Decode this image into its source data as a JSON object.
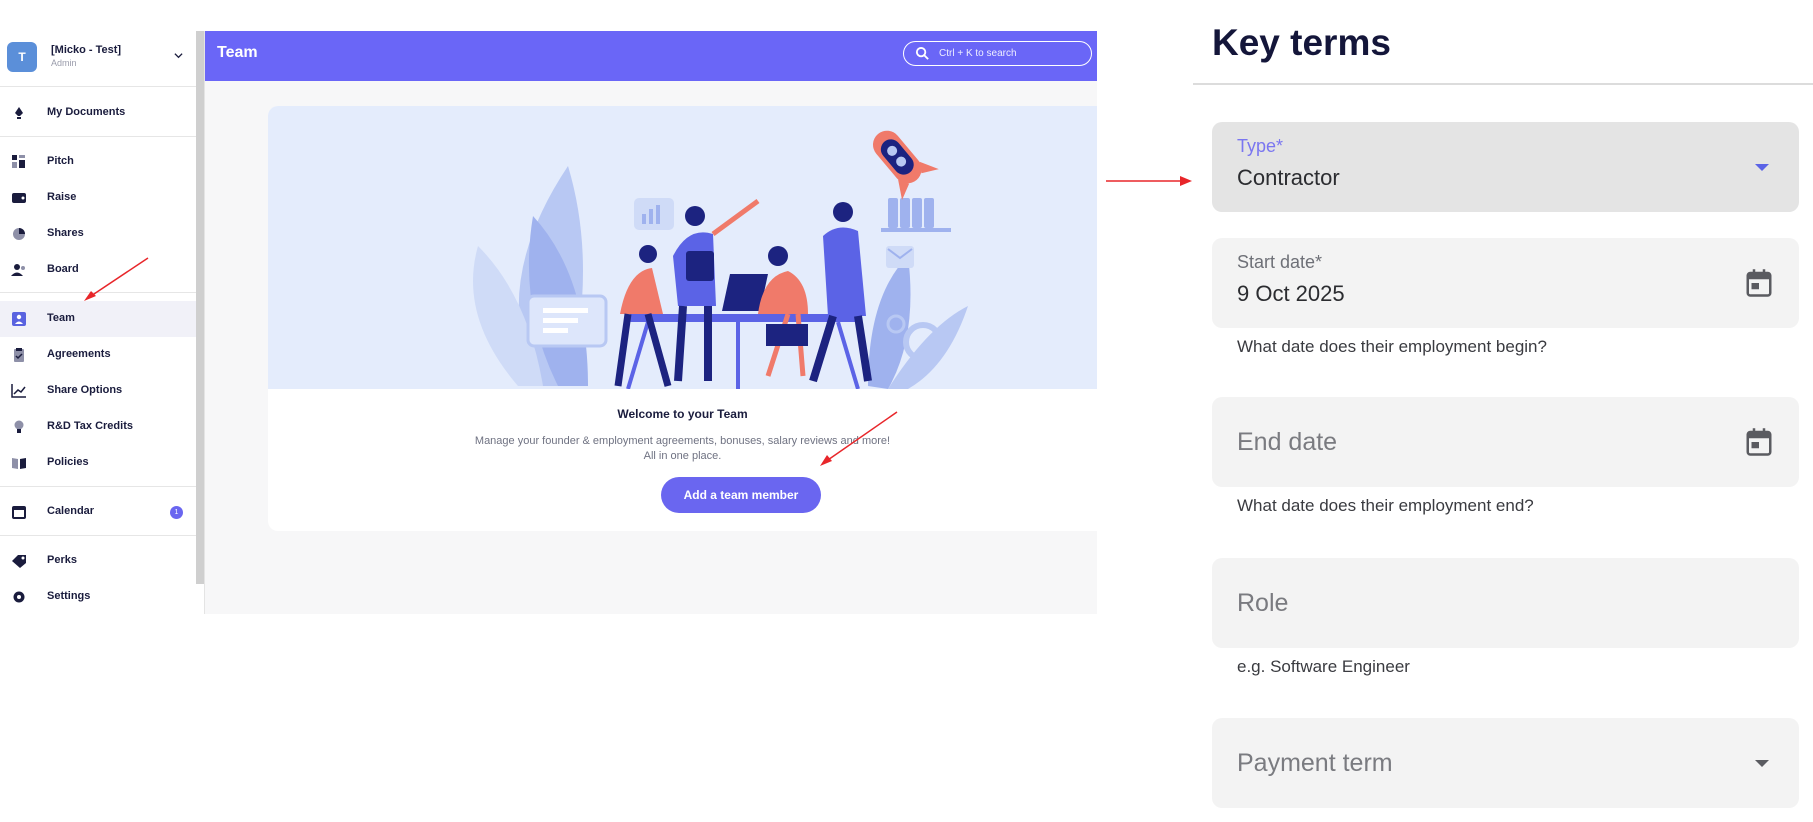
{
  "org": {
    "avatar_letter": "T",
    "name": "[Micko - Test]",
    "role": "Admin"
  },
  "sidebar": {
    "items": [
      {
        "label": "My Documents",
        "icon": "pen-nib-icon"
      },
      {
        "label": "Pitch",
        "icon": "pitch-blocks-icon"
      },
      {
        "label": "Raise",
        "icon": "wallet-icon"
      },
      {
        "label": "Shares",
        "icon": "pie-chart-icon"
      },
      {
        "label": "Board",
        "icon": "people-icon"
      },
      {
        "label": "Team",
        "icon": "person-badge-icon",
        "active": true
      },
      {
        "label": "Agreements",
        "icon": "clipboard-icon"
      },
      {
        "label": "Share Options",
        "icon": "line-chart-icon"
      },
      {
        "label": "R&D Tax Credits",
        "icon": "lightbulb-icon"
      },
      {
        "label": "Policies",
        "icon": "book-icon"
      },
      {
        "label": "Calendar",
        "icon": "calendar-icon",
        "badge": "1"
      },
      {
        "label": "Perks",
        "icon": "tag-icon"
      },
      {
        "label": "Settings",
        "icon": "gear-icon"
      }
    ]
  },
  "topbar": {
    "title": "Team",
    "search_placeholder": "Ctrl + K to search"
  },
  "team_empty": {
    "title": "Welcome to your Team",
    "description_line1": "Manage your founder & employment agreements, bonuses, salary reviews and more!",
    "description_line2": "All in one place.",
    "add_button": "Add a team member"
  },
  "form": {
    "title": "Key terms",
    "type": {
      "label": "Type*",
      "value": "Contractor"
    },
    "start_date": {
      "label": "Start date*",
      "value": "9 Oct 2025",
      "helper": "What date does their employment begin?"
    },
    "end_date": {
      "placeholder": "End date",
      "helper": "What date does their employment end?"
    },
    "role": {
      "placeholder": "Role",
      "helper": "e.g. Software Engineer"
    },
    "payment_term": {
      "placeholder": "Payment term"
    }
  },
  "colors": {
    "brand": "#6a66f7",
    "annotation_arrow": "#e8262a",
    "accent_label": "#7a76f0"
  }
}
